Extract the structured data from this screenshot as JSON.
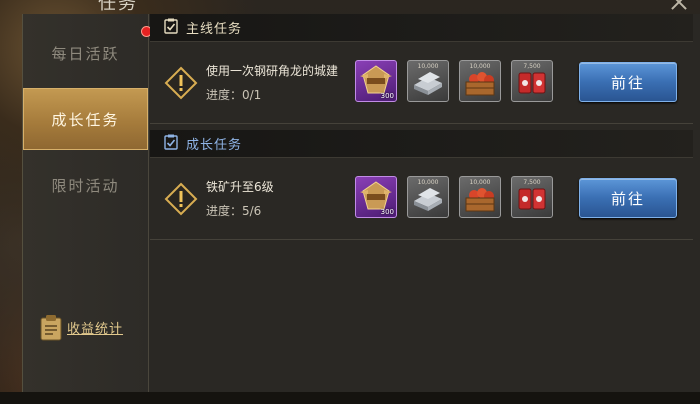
{
  "window": {
    "title": "任务"
  },
  "sidebar": {
    "tabs": [
      {
        "label": "每日活跃",
        "active": false
      },
      {
        "label": "成长任务",
        "active": true
      },
      {
        "label": "限时活动",
        "active": false
      }
    ],
    "income_label": "收益统计"
  },
  "sections": [
    {
      "title": "主线任务",
      "color": "#e6dcc0",
      "task": {
        "title": "使用一次钢研角龙的城建",
        "progress": "进度：0/1",
        "button": "前往",
        "rewards": [
          {
            "icon": "exp-badge-icon",
            "count": "300"
          },
          {
            "icon": "steel-ingot-icon",
            "amount": "10,000"
          },
          {
            "icon": "food-crate-icon",
            "amount": "10,000"
          },
          {
            "icon": "oil-barrel-icon",
            "amount": "7,500"
          }
        ]
      }
    },
    {
      "title": "成长任务",
      "color": "#8fb4e6",
      "task": {
        "title": "铁矿升至6级",
        "progress": "进度：5/6",
        "button": "前往",
        "rewards": [
          {
            "icon": "exp-badge-icon",
            "count": "300"
          },
          {
            "icon": "steel-ingot-icon",
            "amount": "10,000"
          },
          {
            "icon": "food-crate-icon",
            "amount": "10,000"
          },
          {
            "icon": "oil-barrel-icon",
            "amount": "7,500"
          }
        ]
      }
    }
  ],
  "colors": {
    "accent_gold": "#c49a52",
    "button_blue": "#3a6fb3",
    "notification_red": "#e52222"
  }
}
